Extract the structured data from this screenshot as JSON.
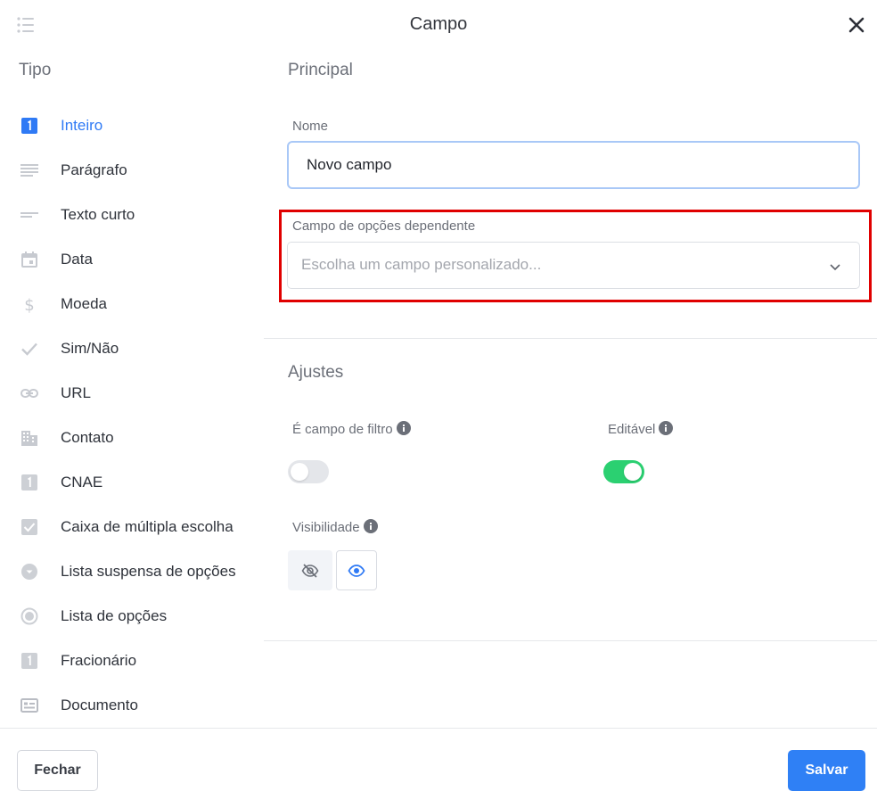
{
  "header": {
    "title": "Campo",
    "menu_icon": "list-icon",
    "close_icon": "close-icon"
  },
  "sidebar": {
    "heading": "Tipo",
    "items": [
      {
        "label": "Inteiro",
        "icon": "integer-icon",
        "active": true
      },
      {
        "label": "Parágrafo",
        "icon": "paragraph-icon"
      },
      {
        "label": "Texto curto",
        "icon": "short-text-icon"
      },
      {
        "label": "Data",
        "icon": "calendar-icon"
      },
      {
        "label": "Moeda",
        "icon": "dollar-icon"
      },
      {
        "label": "Sim/Não",
        "icon": "check-icon"
      },
      {
        "label": "URL",
        "icon": "link-icon"
      },
      {
        "label": "Contato",
        "icon": "building-icon"
      },
      {
        "label": "CNAE",
        "icon": "integer-icon"
      },
      {
        "label": "Caixa de múltipla escolha",
        "icon": "checkbox-icon"
      },
      {
        "label": "Lista suspensa de opções",
        "icon": "dropdown-circle-icon"
      },
      {
        "label": "Lista de opções",
        "icon": "radio-icon"
      },
      {
        "label": "Fracionário",
        "icon": "integer-icon"
      },
      {
        "label": "Documento",
        "icon": "id-card-icon"
      }
    ]
  },
  "main": {
    "principal_title": "Principal",
    "name_label": "Nome",
    "name_value": "Novo campo",
    "dependent_label": "Campo de opções dependente",
    "dependent_placeholder": "Escolha um campo personalizado...",
    "settings_title": "Ajustes",
    "filter_label": "É campo de filtro",
    "filter_on": false,
    "editable_label": "Editável",
    "editable_on": true,
    "visibility_label": "Visibilidade",
    "visibility_selected": "visible"
  },
  "footer": {
    "close_label": "Fechar",
    "save_label": "Salvar"
  },
  "colors": {
    "accent": "#2f80f5",
    "active_text": "#2f7af5",
    "toggle_on": "#2bd071",
    "highlight": "#e00000",
    "icon_gray": "#c7cad0"
  }
}
